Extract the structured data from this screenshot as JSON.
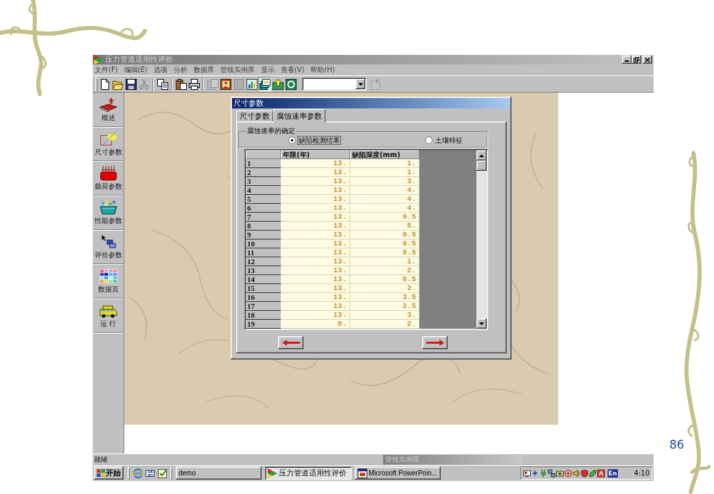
{
  "slide": {
    "page_number": "86"
  },
  "window": {
    "title": "压力管道适用性评价"
  },
  "menu": [
    "文件(F)",
    "编辑(E)",
    "选项",
    "分析",
    "数据库",
    "管线实例库",
    "显示",
    "查看(V)",
    "帮助(H)"
  ],
  "toolbar": {
    "groups": [
      [
        {
          "kind": "new",
          "disabled": false,
          "pressed": false
        },
        {
          "kind": "open",
          "disabled": false,
          "pressed": false
        },
        {
          "kind": "save",
          "disabled": false,
          "pressed": false
        },
        {
          "kind": "cut",
          "disabled": true,
          "pressed": false
        }
      ],
      [
        {
          "kind": "copy",
          "disabled": false,
          "pressed": false
        }
      ],
      [
        {
          "kind": "paste",
          "disabled": false,
          "pressed": false
        },
        {
          "kind": "print",
          "disabled": false,
          "pressed": false
        }
      ],
      [
        {
          "kind": "page",
          "disabled": true,
          "pressed": false
        },
        {
          "kind": "picture",
          "disabled": false,
          "pressed": false
        },
        {
          "kind": "square",
          "disabled": true,
          "pressed": false
        },
        {
          "kind": "chart",
          "disabled": false,
          "pressed": false
        },
        {
          "kind": "stack",
          "disabled": false,
          "pressed": true
        },
        {
          "kind": "upload",
          "disabled": false,
          "pressed": false
        },
        {
          "kind": "ring",
          "disabled": false,
          "pressed": false
        }
      ]
    ],
    "after_combo": [
      {
        "kind": "pin",
        "disabled": true,
        "pressed": false
      }
    ]
  },
  "sidebar": [
    {
      "kind": "overview",
      "label": "概述"
    },
    {
      "kind": "size",
      "label": "尺寸参数"
    },
    {
      "kind": "load",
      "label": "载荷参数"
    },
    {
      "kind": "property",
      "label": "性能参数"
    },
    {
      "kind": "evaluation",
      "label": "评价参数"
    },
    {
      "kind": "data",
      "label": "数据页"
    },
    {
      "kind": "run",
      "label": "运 行"
    }
  ],
  "dialog": {
    "title": "尺寸参数",
    "tabs": [
      {
        "label": "尺寸参数",
        "selected": false
      },
      {
        "label": "腐蚀速率参数",
        "selected": true
      }
    ],
    "group": {
      "title": "腐蚀速率的确定",
      "options": [
        {
          "label": "缺陷检测结果",
          "selected": true
        },
        {
          "label": "土壤特征",
          "selected": false
        }
      ]
    },
    "table": {
      "columns": [
        "年限(年)",
        "缺陷深度(mm)"
      ],
      "rows": [
        {
          "header": "1",
          "cells": [
            "13.",
            "1."
          ]
        },
        {
          "header": "2",
          "cells": [
            "13.",
            "1."
          ]
        },
        {
          "header": "3",
          "cells": [
            "13.",
            "3."
          ]
        },
        {
          "header": "4",
          "cells": [
            "13.",
            "4."
          ]
        },
        {
          "header": "5",
          "cells": [
            "13.",
            "4."
          ]
        },
        {
          "header": "6",
          "cells": [
            "13.",
            "4."
          ]
        },
        {
          "header": "7",
          "cells": [
            "13.",
            "0.5"
          ]
        },
        {
          "header": "8",
          "cells": [
            "13.",
            "5."
          ]
        },
        {
          "header": "9",
          "cells": [
            "13.",
            "0.5"
          ]
        },
        {
          "header": "10",
          "cells": [
            "13.",
            "0.5"
          ]
        },
        {
          "header": "11",
          "cells": [
            "13.",
            "0.5"
          ]
        },
        {
          "header": "12",
          "cells": [
            "13.",
            "1."
          ]
        },
        {
          "header": "13",
          "cells": [
            "13.",
            "2."
          ]
        },
        {
          "header": "14",
          "cells": [
            "13.",
            "0.5"
          ]
        },
        {
          "header": "15",
          "cells": [
            "13.",
            "2."
          ]
        },
        {
          "header": "16",
          "cells": [
            "13.",
            "3.5"
          ]
        },
        {
          "header": "17",
          "cells": [
            "13.",
            "2.5"
          ]
        },
        {
          "header": "18",
          "cells": [
            "13.",
            "3."
          ]
        },
        {
          "header": "19",
          "cells": [
            "8.",
            "2."
          ]
        }
      ]
    },
    "buttons": [
      {
        "kind": "back"
      },
      {
        "kind": "forward"
      }
    ]
  },
  "status_bar": {
    "text": "就绪",
    "minimized_window": "管线实例库"
  },
  "taskbar": {
    "start": "开始",
    "tasks": [
      {
        "kind": "plain",
        "label": "demo",
        "selected": false
      },
      {
        "kind": "app",
        "label": "压力管道适用性评价",
        "selected": true
      },
      {
        "kind": "slides",
        "label": "Microsoft PowerPoin...",
        "selected": false
      }
    ],
    "input_language": "En",
    "clock": "4:10"
  }
}
